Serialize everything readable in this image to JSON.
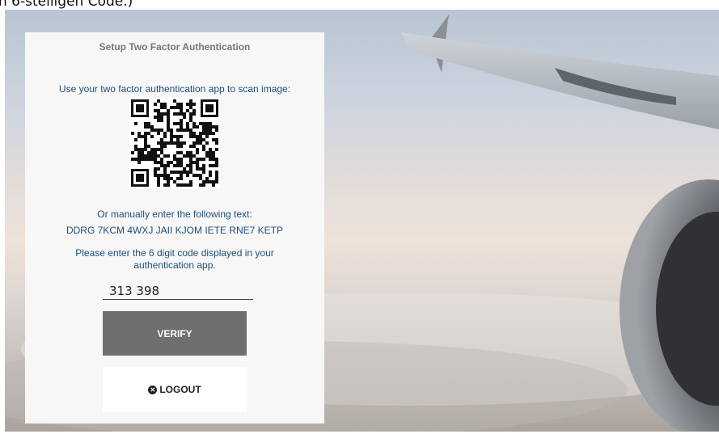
{
  "caption": "n 6-stelligen Code.)",
  "card": {
    "title": "Setup Two Factor Authentication",
    "scan_instruction": "Use your two factor authentication app to scan image:",
    "manual_instruction": "Or manually enter the following text:",
    "secret": "DDRG 7KCM 4WXJ JAII KJOM IETE RNE7 KETP",
    "code_instruction": "Please enter the 6 digit code displayed in your authentication app.",
    "code_value": "313 398",
    "verify_label": "VERIFY",
    "logout_label": "LOGOUT",
    "logout_icon": "x-circle-icon"
  },
  "colors": {
    "card_text": "#1f4f7a",
    "verify_button": "#6f6f6f"
  }
}
